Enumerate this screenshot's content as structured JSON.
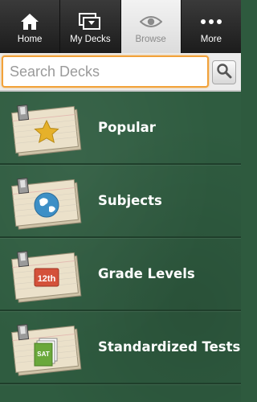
{
  "tabs": [
    {
      "label": "Home",
      "icon": "home-icon",
      "active": false
    },
    {
      "label": "My Decks",
      "icon": "my-decks-icon",
      "active": false
    },
    {
      "label": "Browse",
      "icon": "eye-icon",
      "active": true
    },
    {
      "label": "More",
      "icon": "more-dots-icon",
      "active": false
    }
  ],
  "search": {
    "placeholder": "Search Decks",
    "value": "",
    "button_icon": "search-icon"
  },
  "categories": [
    {
      "label": "Popular",
      "icon": "star-icon"
    },
    {
      "label": "Subjects",
      "icon": "globe-icon"
    },
    {
      "label": "Grade Levels",
      "icon": "grade-12th-icon",
      "badge_text": "12th"
    },
    {
      "label": "Standardized Tests",
      "icon": "sat-books-icon",
      "badge_text": "SAT"
    }
  ],
  "colors": {
    "accent_orange": "#f2a23a",
    "chalkboard_green": "#2f5c40",
    "star_gold": "#e6b12a",
    "globe_blue": "#3d8fc6",
    "grade_red": "#d4513a",
    "sat_green": "#6aa83b"
  }
}
